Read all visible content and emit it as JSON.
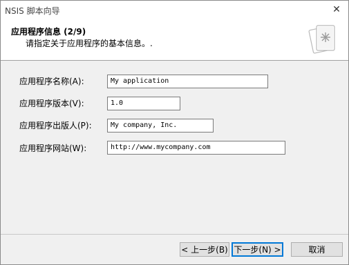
{
  "window": {
    "title": "NSIS 脚本向导",
    "close_glyph": "✕"
  },
  "header": {
    "title": "应用程序信息 (2/9)",
    "subtitle": "请指定关于应用程序的基本信息。."
  },
  "fields": [
    {
      "label": "应用程序名称(A):",
      "value": "My application"
    },
    {
      "label": "应用程序版本(V):",
      "value": "1.0"
    },
    {
      "label": "应用程序出版人(P):",
      "value": "My company, Inc."
    },
    {
      "label": "应用程序网站(W):",
      "value": "http://www.mycompany.com"
    }
  ],
  "buttons": {
    "back": "< 上一步(B)",
    "next": "下一步(N) >",
    "cancel": "取消"
  }
}
